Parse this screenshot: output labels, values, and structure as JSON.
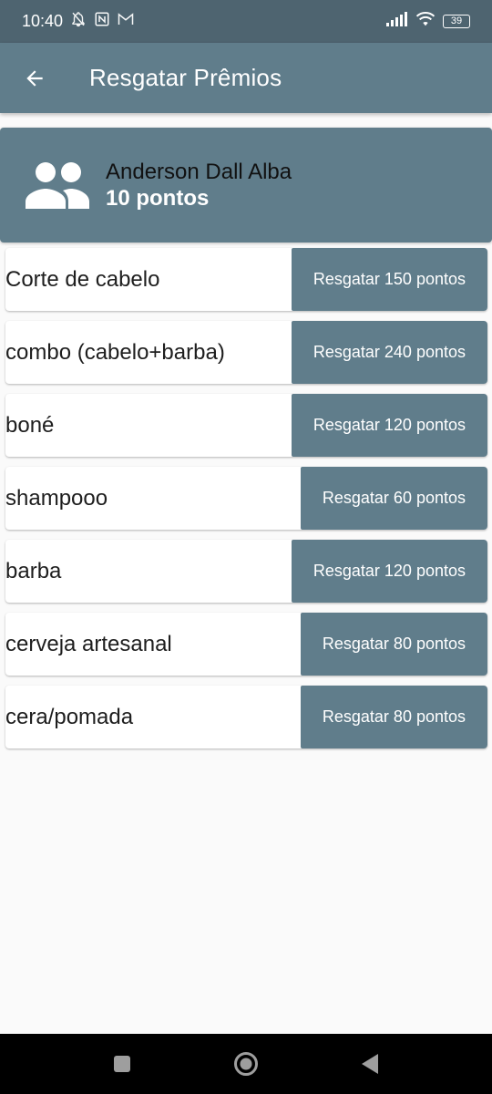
{
  "status_bar": {
    "time": "10:40",
    "left_icons": [
      "bell-off-icon",
      "nfc-icon",
      "gmail-icon"
    ],
    "right_icons": [
      "signal-icon",
      "wifi-icon"
    ],
    "battery": "39"
  },
  "app_bar": {
    "title": "Resgatar Prêmios"
  },
  "user": {
    "name": "Anderson Dall Alba",
    "points": "10 pontos"
  },
  "rewards": [
    {
      "name": "Corte de cabelo",
      "button": "Resgatar 150 pontos"
    },
    {
      "name": "combo (cabelo+barba)",
      "button": "Resgatar 240 pontos"
    },
    {
      "name": "boné",
      "button": "Resgatar 120 pontos"
    },
    {
      "name": "shampooo",
      "button": "Resgatar 60 pontos"
    },
    {
      "name": "barba",
      "button": "Resgatar 120 pontos"
    },
    {
      "name": "cerveja artesanal",
      "button": "Resgatar 80 pontos"
    },
    {
      "name": "cera/pomada",
      "button": "Resgatar 80 pontos"
    }
  ],
  "colors": {
    "primary": "#607d8b",
    "status_bar": "#4e6470",
    "background": "#fafafa"
  }
}
